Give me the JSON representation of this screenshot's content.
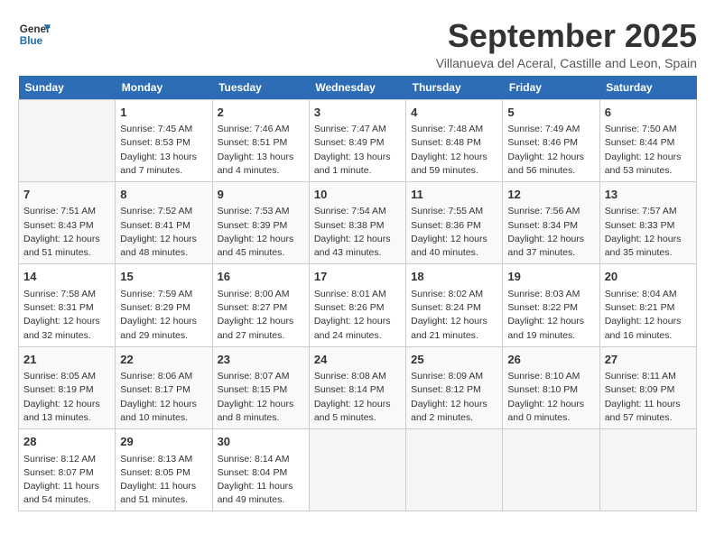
{
  "header": {
    "logo_line1": "General",
    "logo_line2": "Blue",
    "month_title": "September 2025",
    "subtitle": "Villanueva del Aceral, Castille and Leon, Spain"
  },
  "days_of_week": [
    "Sunday",
    "Monday",
    "Tuesday",
    "Wednesday",
    "Thursday",
    "Friday",
    "Saturday"
  ],
  "weeks": [
    [
      {
        "day": "",
        "info": ""
      },
      {
        "day": "1",
        "info": "Sunrise: 7:45 AM\nSunset: 8:53 PM\nDaylight: 13 hours\nand 7 minutes."
      },
      {
        "day": "2",
        "info": "Sunrise: 7:46 AM\nSunset: 8:51 PM\nDaylight: 13 hours\nand 4 minutes."
      },
      {
        "day": "3",
        "info": "Sunrise: 7:47 AM\nSunset: 8:49 PM\nDaylight: 13 hours\nand 1 minute."
      },
      {
        "day": "4",
        "info": "Sunrise: 7:48 AM\nSunset: 8:48 PM\nDaylight: 12 hours\nand 59 minutes."
      },
      {
        "day": "5",
        "info": "Sunrise: 7:49 AM\nSunset: 8:46 PM\nDaylight: 12 hours\nand 56 minutes."
      },
      {
        "day": "6",
        "info": "Sunrise: 7:50 AM\nSunset: 8:44 PM\nDaylight: 12 hours\nand 53 minutes."
      }
    ],
    [
      {
        "day": "7",
        "info": "Sunrise: 7:51 AM\nSunset: 8:43 PM\nDaylight: 12 hours\nand 51 minutes."
      },
      {
        "day": "8",
        "info": "Sunrise: 7:52 AM\nSunset: 8:41 PM\nDaylight: 12 hours\nand 48 minutes."
      },
      {
        "day": "9",
        "info": "Sunrise: 7:53 AM\nSunset: 8:39 PM\nDaylight: 12 hours\nand 45 minutes."
      },
      {
        "day": "10",
        "info": "Sunrise: 7:54 AM\nSunset: 8:38 PM\nDaylight: 12 hours\nand 43 minutes."
      },
      {
        "day": "11",
        "info": "Sunrise: 7:55 AM\nSunset: 8:36 PM\nDaylight: 12 hours\nand 40 minutes."
      },
      {
        "day": "12",
        "info": "Sunrise: 7:56 AM\nSunset: 8:34 PM\nDaylight: 12 hours\nand 37 minutes."
      },
      {
        "day": "13",
        "info": "Sunrise: 7:57 AM\nSunset: 8:33 PM\nDaylight: 12 hours\nand 35 minutes."
      }
    ],
    [
      {
        "day": "14",
        "info": "Sunrise: 7:58 AM\nSunset: 8:31 PM\nDaylight: 12 hours\nand 32 minutes."
      },
      {
        "day": "15",
        "info": "Sunrise: 7:59 AM\nSunset: 8:29 PM\nDaylight: 12 hours\nand 29 minutes."
      },
      {
        "day": "16",
        "info": "Sunrise: 8:00 AM\nSunset: 8:27 PM\nDaylight: 12 hours\nand 27 minutes."
      },
      {
        "day": "17",
        "info": "Sunrise: 8:01 AM\nSunset: 8:26 PM\nDaylight: 12 hours\nand 24 minutes."
      },
      {
        "day": "18",
        "info": "Sunrise: 8:02 AM\nSunset: 8:24 PM\nDaylight: 12 hours\nand 21 minutes."
      },
      {
        "day": "19",
        "info": "Sunrise: 8:03 AM\nSunset: 8:22 PM\nDaylight: 12 hours\nand 19 minutes."
      },
      {
        "day": "20",
        "info": "Sunrise: 8:04 AM\nSunset: 8:21 PM\nDaylight: 12 hours\nand 16 minutes."
      }
    ],
    [
      {
        "day": "21",
        "info": "Sunrise: 8:05 AM\nSunset: 8:19 PM\nDaylight: 12 hours\nand 13 minutes."
      },
      {
        "day": "22",
        "info": "Sunrise: 8:06 AM\nSunset: 8:17 PM\nDaylight: 12 hours\nand 10 minutes."
      },
      {
        "day": "23",
        "info": "Sunrise: 8:07 AM\nSunset: 8:15 PM\nDaylight: 12 hours\nand 8 minutes."
      },
      {
        "day": "24",
        "info": "Sunrise: 8:08 AM\nSunset: 8:14 PM\nDaylight: 12 hours\nand 5 minutes."
      },
      {
        "day": "25",
        "info": "Sunrise: 8:09 AM\nSunset: 8:12 PM\nDaylight: 12 hours\nand 2 minutes."
      },
      {
        "day": "26",
        "info": "Sunrise: 8:10 AM\nSunset: 8:10 PM\nDaylight: 12 hours\nand 0 minutes."
      },
      {
        "day": "27",
        "info": "Sunrise: 8:11 AM\nSunset: 8:09 PM\nDaylight: 11 hours\nand 57 minutes."
      }
    ],
    [
      {
        "day": "28",
        "info": "Sunrise: 8:12 AM\nSunset: 8:07 PM\nDaylight: 11 hours\nand 54 minutes."
      },
      {
        "day": "29",
        "info": "Sunrise: 8:13 AM\nSunset: 8:05 PM\nDaylight: 11 hours\nand 51 minutes."
      },
      {
        "day": "30",
        "info": "Sunrise: 8:14 AM\nSunset: 8:04 PM\nDaylight: 11 hours\nand 49 minutes."
      },
      {
        "day": "",
        "info": ""
      },
      {
        "day": "",
        "info": ""
      },
      {
        "day": "",
        "info": ""
      },
      {
        "day": "",
        "info": ""
      }
    ]
  ]
}
